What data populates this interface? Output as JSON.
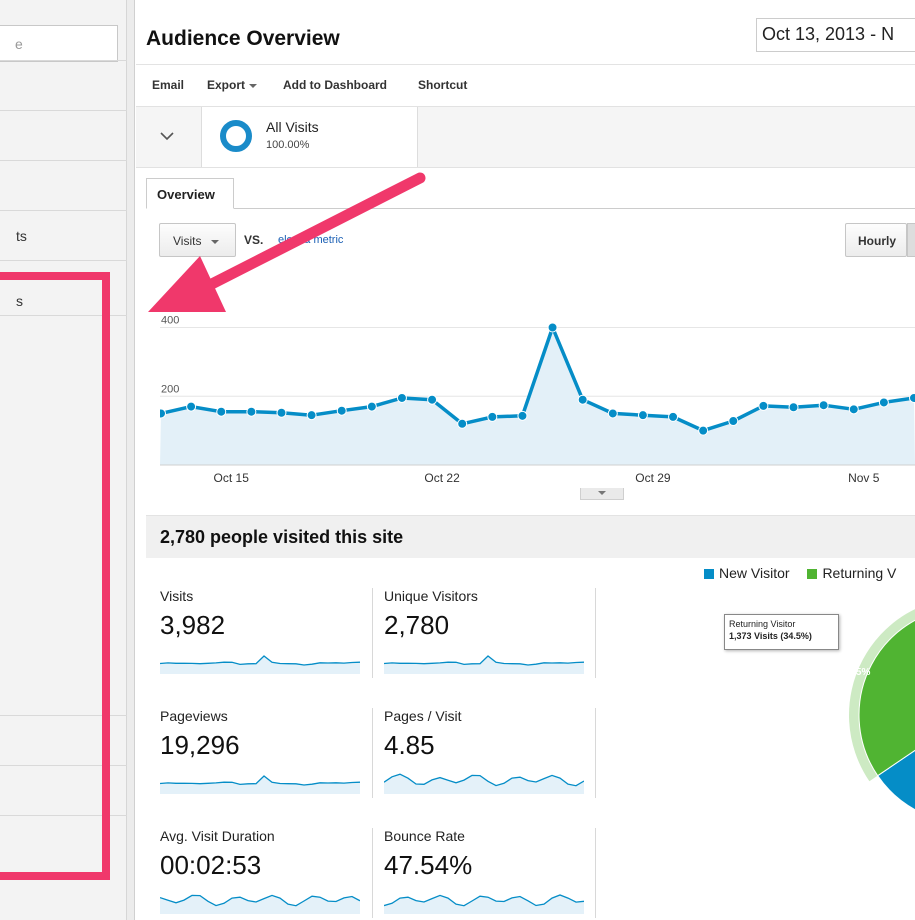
{
  "sidebar": {
    "search_placeholder": "e",
    "items": [
      "",
      "",
      "",
      "ts",
      "s",
      "",
      "",
      "",
      ""
    ]
  },
  "header": {
    "title": "Audience Overview",
    "date_range": "Oct 13, 2013 - N"
  },
  "toolbar": {
    "email": "Email",
    "export": "Export",
    "add_to_dashboard": "Add to Dashboard",
    "shortcut": "Shortcut"
  },
  "segment": {
    "name": "All Visits",
    "percent": "100.00%"
  },
  "tabs": {
    "overview": "Overview"
  },
  "chart_controls": {
    "metric": "Visits",
    "vs": "VS.",
    "select_metric": "elect a metric",
    "hourly": "Hourly"
  },
  "chart_data": {
    "type": "area",
    "x_labels": [
      "Oct 15",
      "Oct 22",
      "Oct 29",
      "Nov 5"
    ],
    "y_ticks": [
      "400",
      "200"
    ],
    "ylim": [
      0,
      480
    ],
    "grid": true,
    "color": "#058dc7",
    "values": [
      150,
      170,
      155,
      155,
      152,
      145,
      158,
      170,
      195,
      190,
      120,
      140,
      143,
      400,
      190,
      150,
      145,
      140,
      100,
      128,
      172,
      168,
      174,
      162,
      182,
      195
    ]
  },
  "summary": {
    "title": "2,780 people visited this site",
    "metrics": [
      {
        "label": "Visits",
        "value": "3,982"
      },
      {
        "label": "Unique Visitors",
        "value": "2,780"
      },
      {
        "label": "Pageviews",
        "value": "19,296"
      },
      {
        "label": "Pages / Visit",
        "value": "4.85"
      },
      {
        "label": "Avg. Visit Duration",
        "value": "00:02:53"
      },
      {
        "label": "Bounce Rate",
        "value": "47.54%"
      }
    ]
  },
  "pie": {
    "legend": [
      "New Visitor",
      "Returning V"
    ],
    "colors": [
      "#058dc7",
      "#50b432"
    ],
    "values": [
      65.5,
      34.5
    ],
    "labels": [
      "65.5",
      "34.5%"
    ],
    "tooltip_title": "Returning Visitor",
    "tooltip_value": "1,373 Visits (34.5%)"
  },
  "annotation_color": "#f0386b"
}
